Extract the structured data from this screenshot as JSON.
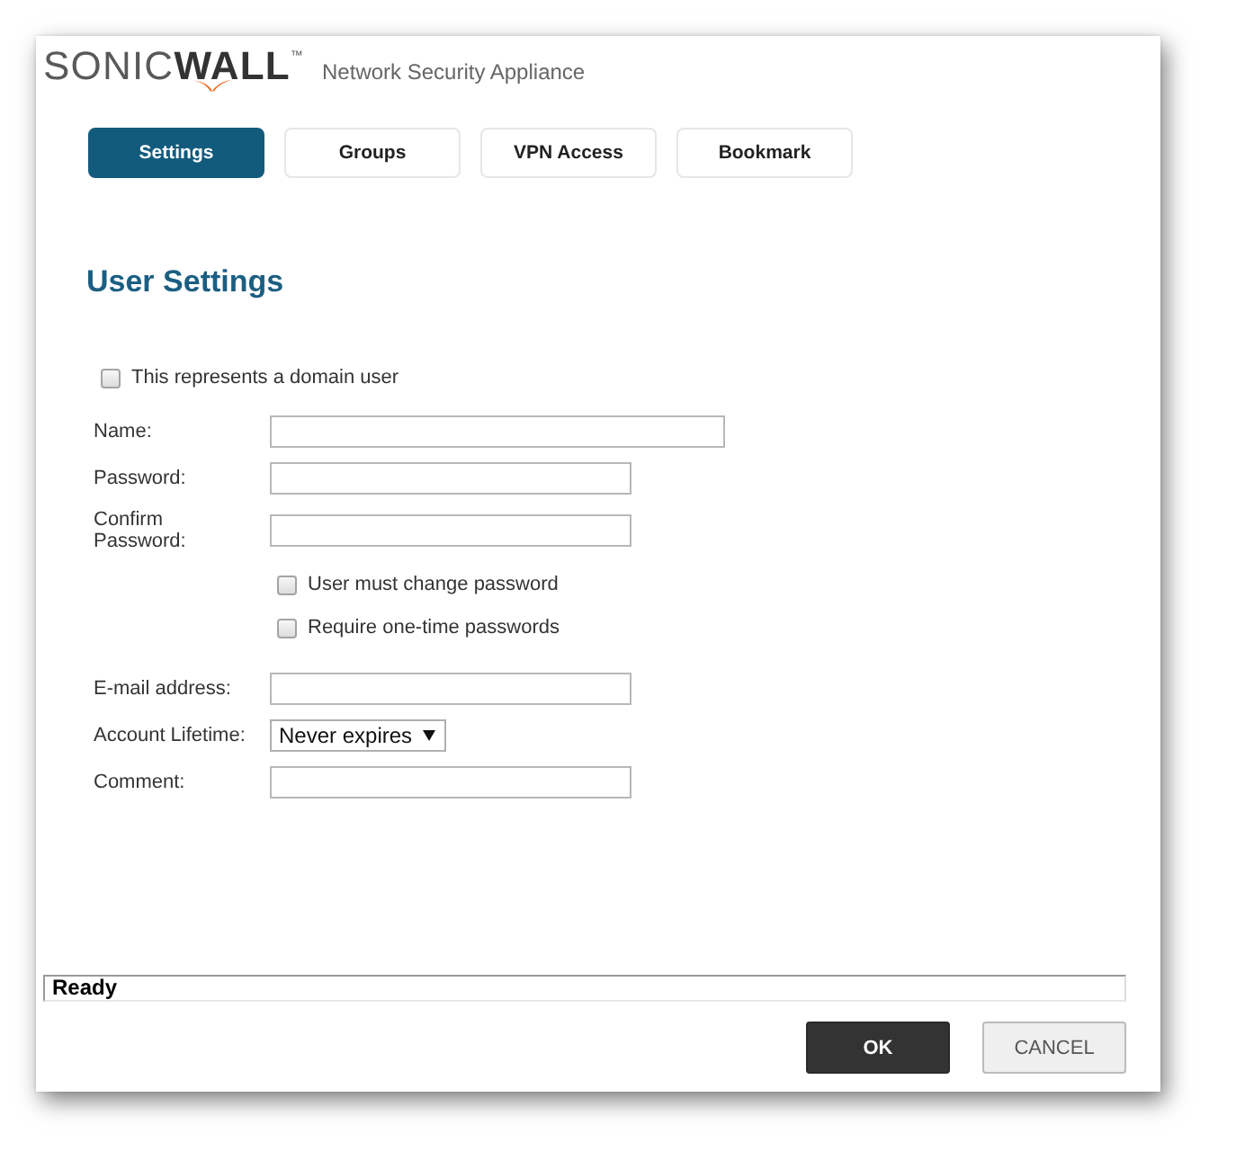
{
  "header": {
    "logo": "SONIC**WALL**$^{™}$",
    "product": "Network Security Appliance"
  },
  "tabs": [
    {
      "label": "Settings",
      "selected": true
    },
    {
      "label": "Groups",
      "selected": false
    },
    {
      "label": "VPN Access",
      "selected": false
    },
    {
      "label": "Bookmark",
      "selected": false
    }
  ],
  "heading": "User Settings",
  "domain_user": {
    "label": "This represents a domain user",
    "checked": false
  },
  "fields": [
    {
      "kind": "text",
      "label": "Name:"
    },
    {
      "kind": "text",
      "label": "Password:"
    },
    {
      "kind": "text",
      "label": "Confirm Password:"
    },
    {
      "kind": "checkbox",
      "label": "User must change password",
      "checked": false
    },
    {
      "kind": "checkbox",
      "label": "Require one-time passwords",
      "checked": false
    },
    {
      "kind": "text",
      "label": "E-mail address:"
    },
    {
      "kind": "select",
      "label": "Account Lifetime:",
      "value": "Never expires"
    },
    {
      "kind": "text",
      "label": "Comment:"
    }
  ],
  "status_bar": {
    "text": "Ready"
  },
  "buttons": [
    {
      "label": "OK",
      "kind": "primary"
    },
    {
      "label": "CANCEL",
      "kind": "secondary"
    }
  ]
}
